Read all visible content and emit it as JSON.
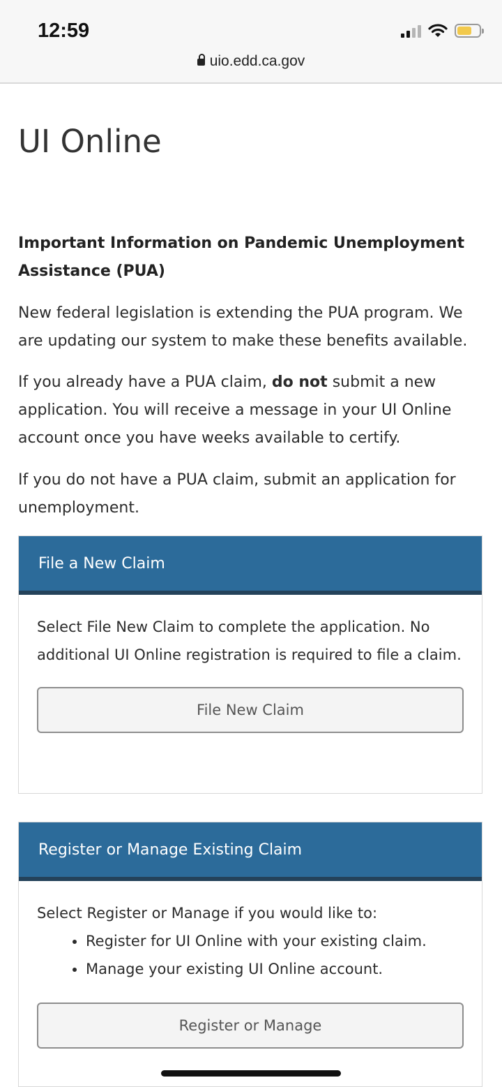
{
  "status_bar": {
    "time": "12:59",
    "url": "uio.edd.ca.gov",
    "icons": [
      "cellular-signal-icon",
      "wifi-icon",
      "battery-icon"
    ]
  },
  "page": {
    "title": "UI Online",
    "notice_heading": "Important Information on Pandemic Unemployment Assistance (PUA)",
    "paragraph_1": "New federal legislation is extending the PUA program. We are updating our system to make these benefits available.",
    "paragraph_2_before": "If you already have a PUA claim, ",
    "paragraph_2_bold": "do not",
    "paragraph_2_after": " submit a new application. You will receive a message in your UI Online account once you have weeks available to certify.",
    "paragraph_3": "If you do not have a PUA claim, submit an application for unemployment."
  },
  "new_claim_panel": {
    "heading": "File a New Claim",
    "text": "Select File New Claim to complete the application. No additional UI Online registration is required to file a claim.",
    "button_label": "File New Claim"
  },
  "manage_panel": {
    "heading": "Register or Manage Existing Claim",
    "intro": "Select Register or Manage if you would like to:",
    "bullets": [
      "Register for UI Online with your existing claim.",
      "Manage your existing UI Online account."
    ],
    "button_label": "Register or Manage"
  },
  "colors": {
    "panel_header": "#2c6b9a",
    "panel_header_border": "#24425a",
    "battery": "#f2c94c"
  }
}
